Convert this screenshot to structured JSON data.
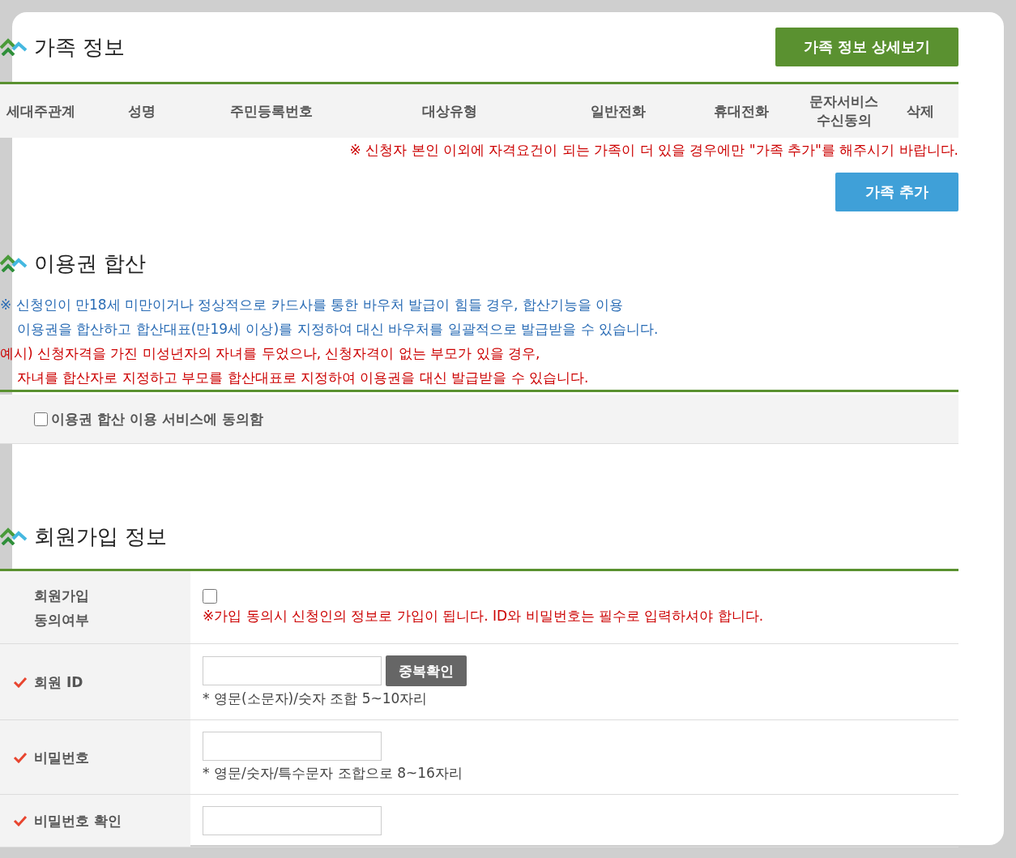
{
  "family": {
    "title": "가족 정보",
    "detail_button": "가족 정보 상세보기",
    "columns": [
      "세대주관계",
      "성명",
      "주민등록번호",
      "대상유형",
      "일반전화",
      "휴대전화",
      "문자서비스 수신동의",
      "삭제"
    ],
    "note": "※ 신청자 본인 이외에 자격요건이 되는 가족이 더 있을 경우에만 \"가족 추가\"를 해주시기 바랍니다.",
    "add_button": "가족 추가"
  },
  "voucher": {
    "title": "이용권 합산",
    "notes": [
      {
        "kind": "info",
        "text": "※ 신청인이 만18세 미만이거나 정상적으로 카드사를 통한 바우처 발급이 힘들 경우, 합산기능을 이용",
        "indent": false
      },
      {
        "kind": "info",
        "text": "이용권을 합산하고 합산대표(만19세 이상)를 지정하여 대신 바우처를 일괄적으로 발급받을 수 있습니다.",
        "indent": true
      },
      {
        "kind": "example",
        "text": "예시) 신청자격을 가진 미성년자의 자녀를 두었으나, 신청자격이 없는 부모가 있을 경우,",
        "indent": false
      },
      {
        "kind": "example",
        "text": "자녀를 합산자로 지정하고 부모를 합산대표로 지정하여 이용권을 대신 발급받을 수 있습니다.",
        "indent": true
      }
    ],
    "agree": {
      "label": "이용권 합산 이용 서비스에 동의함",
      "checked": false
    }
  },
  "member": {
    "title": "회원가입 정보",
    "rows": [
      {
        "kind": "checkbox",
        "label": "회원가입 동의여부",
        "required": false,
        "checked": false,
        "note": "※가입 동의시 신청인의 정보로 가입이 됩니다. ID와 비밀번호는 필수로 입력하셔야 합니다."
      },
      {
        "kind": "input",
        "label": "회원 ID",
        "required": true,
        "button": "중복확인",
        "hint": "* 영문(소문자)/숫자 조합 5~10자리"
      },
      {
        "kind": "input",
        "label": "비밀번호",
        "required": true,
        "hint": "* 영문/숫자/특수문자 조합으로 8~16자리"
      },
      {
        "kind": "input",
        "label": "비밀번호 확인",
        "required": true
      }
    ]
  }
}
